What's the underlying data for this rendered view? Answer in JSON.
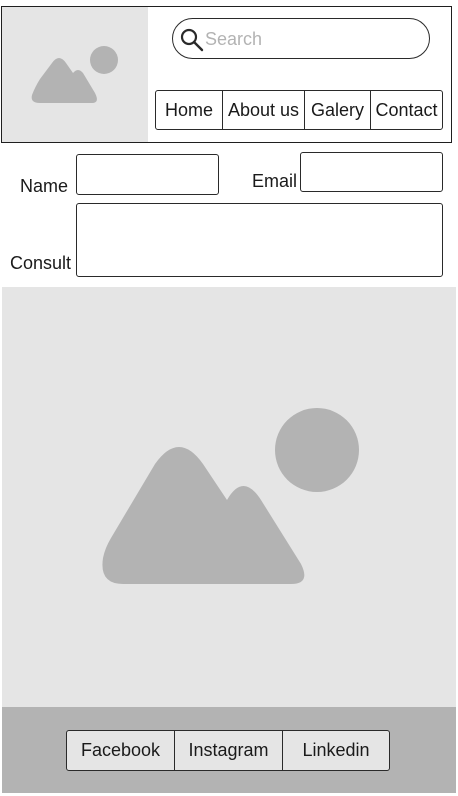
{
  "header": {
    "logo_icon": "image-placeholder-icon",
    "search": {
      "placeholder": "Search",
      "icon": "search-icon"
    },
    "nav": [
      {
        "label": "Home"
      },
      {
        "label": "About us"
      },
      {
        "label": "Galery"
      },
      {
        "label": "Contact"
      }
    ]
  },
  "form": {
    "name_label": "Name",
    "email_label": "Email",
    "consult_label": "Consult",
    "name_value": "",
    "email_value": "",
    "consult_value": ""
  },
  "hero": {
    "icon": "image-placeholder-icon"
  },
  "footer": {
    "social": [
      {
        "label": "Facebook"
      },
      {
        "label": "Instagram"
      },
      {
        "label": "Linkedin"
      }
    ]
  },
  "colors": {
    "placeholder_bg": "#e5e5e5",
    "placeholder_shape": "#b3b3b3",
    "footer_bg": "#b3b3b3",
    "border": "#2a2a2a"
  }
}
